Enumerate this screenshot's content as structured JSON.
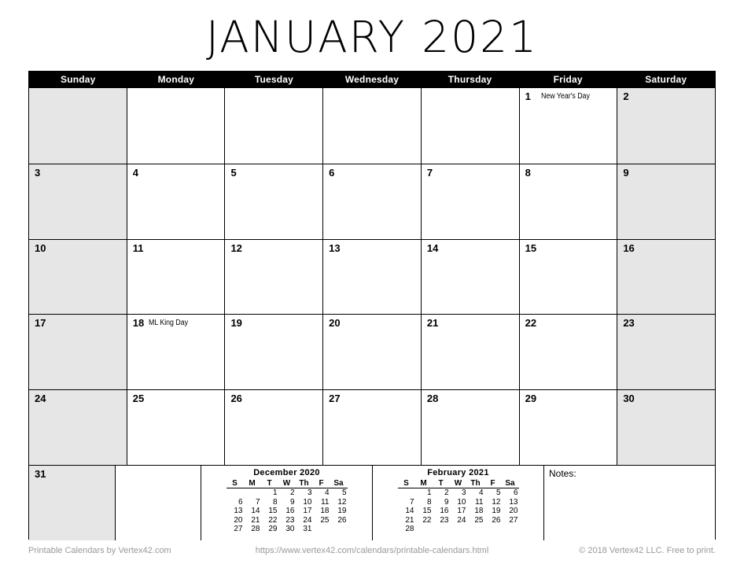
{
  "title": {
    "month": "JANUARY",
    "year": "2021"
  },
  "weekday_headers": [
    "Sunday",
    "Monday",
    "Tuesday",
    "Wednesday",
    "Thursday",
    "Friday",
    "Saturday"
  ],
  "colors": {
    "header_bg": "#000000",
    "header_text": "#ffffff",
    "weekend_bg": "#e6e6e6",
    "cell_bg": "#ffffff",
    "grid_line": "#000000",
    "footer_text": "#999999"
  },
  "weeks": [
    [
      {
        "day": "",
        "event": ""
      },
      {
        "day": "",
        "event": ""
      },
      {
        "day": "",
        "event": ""
      },
      {
        "day": "",
        "event": ""
      },
      {
        "day": "",
        "event": ""
      },
      {
        "day": "1",
        "event": "New Year's Day"
      },
      {
        "day": "2",
        "event": ""
      }
    ],
    [
      {
        "day": "3",
        "event": ""
      },
      {
        "day": "4",
        "event": ""
      },
      {
        "day": "5",
        "event": ""
      },
      {
        "day": "6",
        "event": ""
      },
      {
        "day": "7",
        "event": ""
      },
      {
        "day": "8",
        "event": ""
      },
      {
        "day": "9",
        "event": ""
      }
    ],
    [
      {
        "day": "10",
        "event": ""
      },
      {
        "day": "11",
        "event": ""
      },
      {
        "day": "12",
        "event": ""
      },
      {
        "day": "13",
        "event": ""
      },
      {
        "day": "14",
        "event": ""
      },
      {
        "day": "15",
        "event": ""
      },
      {
        "day": "16",
        "event": ""
      }
    ],
    [
      {
        "day": "17",
        "event": ""
      },
      {
        "day": "18",
        "event": "ML King Day"
      },
      {
        "day": "19",
        "event": ""
      },
      {
        "day": "20",
        "event": ""
      },
      {
        "day": "21",
        "event": ""
      },
      {
        "day": "22",
        "event": ""
      },
      {
        "day": "23",
        "event": ""
      }
    ],
    [
      {
        "day": "24",
        "event": ""
      },
      {
        "day": "25",
        "event": ""
      },
      {
        "day": "26",
        "event": ""
      },
      {
        "day": "27",
        "event": ""
      },
      {
        "day": "28",
        "event": ""
      },
      {
        "day": "29",
        "event": ""
      },
      {
        "day": "30",
        "event": ""
      }
    ]
  ],
  "last_row": {
    "sunday": {
      "day": "31",
      "event": ""
    },
    "monday": {
      "day": "",
      "event": ""
    },
    "notes_label": "Notes:"
  },
  "mini_calendars": [
    {
      "title": "December 2020",
      "weekday_headers": [
        "S",
        "M",
        "T",
        "W",
        "Th",
        "F",
        "Sa"
      ],
      "weeks": [
        [
          "",
          "",
          "1",
          "2",
          "3",
          "4",
          "5"
        ],
        [
          "6",
          "7",
          "8",
          "9",
          "10",
          "11",
          "12"
        ],
        [
          "13",
          "14",
          "15",
          "16",
          "17",
          "18",
          "19"
        ],
        [
          "20",
          "21",
          "22",
          "23",
          "24",
          "25",
          "26"
        ],
        [
          "27",
          "28",
          "29",
          "30",
          "31",
          "",
          ""
        ]
      ]
    },
    {
      "title": "February 2021",
      "weekday_headers": [
        "S",
        "M",
        "T",
        "W",
        "Th",
        "F",
        "Sa"
      ],
      "weeks": [
        [
          "",
          "1",
          "2",
          "3",
          "4",
          "5",
          "6"
        ],
        [
          "7",
          "8",
          "9",
          "10",
          "11",
          "12",
          "13"
        ],
        [
          "14",
          "15",
          "16",
          "17",
          "18",
          "19",
          "20"
        ],
        [
          "21",
          "22",
          "23",
          "24",
          "25",
          "26",
          "27"
        ],
        [
          "28",
          "",
          "",
          "",
          "",
          "",
          ""
        ]
      ]
    }
  ],
  "footer": {
    "left": "Printable Calendars by Vertex42.com",
    "center": "https://www.vertex42.com/calendars/printable-calendars.html",
    "right": "© 2018 Vertex42 LLC. Free to print."
  }
}
